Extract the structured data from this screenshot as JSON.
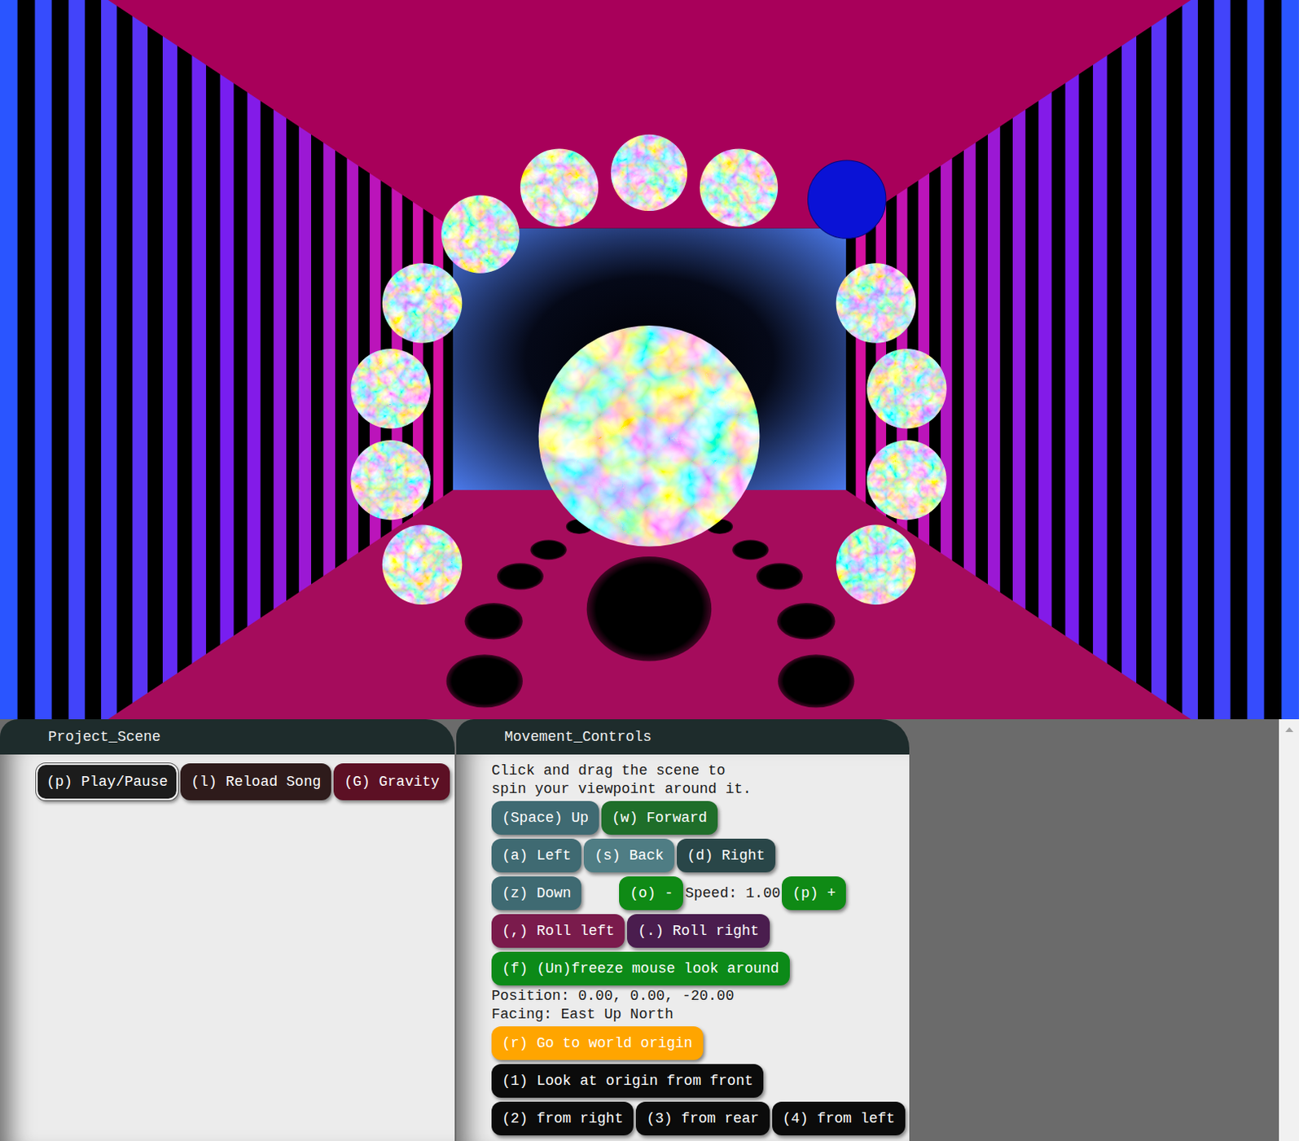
{
  "scene": {
    "spheres": [
      {
        "kind": "marble-large"
      },
      {
        "kind": "marble"
      },
      {
        "kind": "marble"
      },
      {
        "kind": "marble"
      },
      {
        "kind": "marble"
      },
      {
        "kind": "marble"
      },
      {
        "kind": "marble"
      },
      {
        "kind": "marble"
      },
      {
        "kind": "marble"
      },
      {
        "kind": "plain",
        "color": "#0a12d6"
      },
      {
        "kind": "marble"
      },
      {
        "kind": "marble"
      },
      {
        "kind": "marble"
      },
      {
        "kind": "marble"
      }
    ]
  },
  "project_scene": {
    "title": "Project_Scene",
    "buttons": [
      {
        "label": "(p) Play/Pause",
        "color": "#1c1c1c",
        "selected": true
      },
      {
        "label": "(l) Reload Song",
        "color": "#2e1b1b",
        "selected": false
      },
      {
        "label": "(G) Gravity",
        "color": "#5c1024",
        "selected": false
      }
    ]
  },
  "movement_controls": {
    "title": "Movement_Controls",
    "lines": [
      {
        "kind": "text",
        "text": "Click and drag the scene to"
      },
      {
        "kind": "text",
        "text": "spin your viewpoint around it."
      },
      {
        "kind": "buttons",
        "items": [
          {
            "kind": "button",
            "label": "(Space) Up",
            "color": "#3f6a72"
          },
          {
            "kind": "button",
            "label": "(w) Forward",
            "color": "#1f6e2a"
          }
        ],
        "extra": []
      },
      {
        "kind": "buttons",
        "items": [
          {
            "kind": "button",
            "label": "(a) Left",
            "color": "#3f6a72"
          },
          {
            "kind": "button",
            "label": "(s) Back",
            "color": "#4f7d84"
          },
          {
            "kind": "button",
            "label": "(d) Right",
            "color": "#294648"
          }
        ],
        "extra": []
      },
      {
        "kind": "buttons",
        "items": [
          {
            "kind": "button",
            "label": "(z) Down",
            "color": "#3f6a72"
          }
        ],
        "extra": [
          {
            "kind": "button",
            "label": "(o) -",
            "color": "#0f8a15"
          },
          {
            "kind": "text",
            "label": "Speed: 1.00"
          },
          {
            "kind": "button",
            "label": "(p) +",
            "color": "#0f8a15"
          }
        ]
      },
      {
        "kind": "buttons",
        "items": [
          {
            "kind": "button",
            "label": "(,) Roll left",
            "color": "#7a1b4c"
          },
          {
            "kind": "button",
            "label": "(.) Roll right",
            "color": "#4a1d4e"
          }
        ],
        "extra": []
      },
      {
        "kind": "buttons",
        "items": [
          {
            "kind": "button",
            "label": "(f) (Un)freeze mouse look around",
            "color": "#0c8a18"
          }
        ],
        "extra": []
      },
      {
        "kind": "text",
        "text": "Position: 0.00, 0.00, -20.00"
      },
      {
        "kind": "text",
        "text": "Facing: East Up North"
      },
      {
        "kind": "buttons",
        "items": [
          {
            "kind": "button",
            "label": "(r) Go to world origin",
            "color": "#ffa500"
          }
        ],
        "extra": []
      },
      {
        "kind": "buttons",
        "items": [
          {
            "kind": "button",
            "label": "(1) Look at origin from front",
            "color": "#0b0b0b"
          }
        ],
        "extra": []
      },
      {
        "kind": "buttons",
        "items": [
          {
            "kind": "button",
            "label": "(2) from right",
            "color": "#0b0b0b"
          },
          {
            "kind": "button",
            "label": "(3) from rear",
            "color": "#0b0b0b"
          },
          {
            "kind": "button",
            "label": "(4) from left",
            "color": "#0b0b0b"
          }
        ],
        "extra": []
      }
    ]
  }
}
